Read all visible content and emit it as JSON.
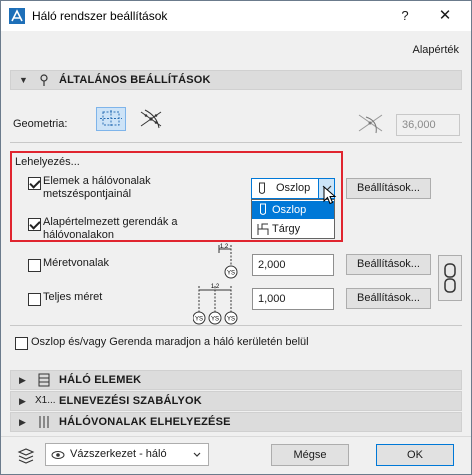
{
  "window": {
    "title": "Háló rendszer beállítások",
    "help": "?",
    "close": "✕"
  },
  "header": {
    "default_label": "Alapérték"
  },
  "general": {
    "title": "ÁLTALÁNOS BEÁLLÍTÁSOK",
    "geometry_label": "Geometria:",
    "angle_value": "36,000"
  },
  "placement": {
    "group_label": "Lehelyezés...",
    "elements_label_line1": "Elemek a hálóvonalak",
    "elements_label_line2": "metszéspontjainál",
    "elements_checked": true,
    "dropdown_value": "Oszlop",
    "dropdown_options": [
      "Oszlop",
      "Tárgy"
    ],
    "beams_label_line1": "Alapértelmezett gerendák a",
    "beams_label_line2": "hálóvonalakon",
    "beams_checked": true,
    "settings_label": "Beállítások..."
  },
  "dimensions": {
    "dim_label": "Méretvonalak",
    "dim_checked": false,
    "dim_value": "2,000",
    "full_label": "Teljes méret",
    "full_checked": false,
    "full_value": "1,000",
    "settings_label": "Beállítások...",
    "icon_ys": "YS",
    "icon_sizes": [
      "1,2",
      "1,2"
    ]
  },
  "boundary": {
    "label": "Oszlop és/vagy Gerenda maradjon a háló kerületén belül",
    "checked": false
  },
  "sections": {
    "grid_elements": "HÁLÓ ELEMEK",
    "naming_rules": "ELNEVEZÉSI SZABÁLYOK",
    "gridline_placement": "HÁLÓVONALAK ELHELYEZÉSE",
    "naming_prefix": "X1..."
  },
  "footer": {
    "layer_value": "Vázszerkezet - háló",
    "cancel_label": "Mégse",
    "ok_label": "OK"
  },
  "colors": {
    "accent": "#0078d7",
    "highlight_box": "#e0252f",
    "section_bg": "#dcdcdc"
  }
}
